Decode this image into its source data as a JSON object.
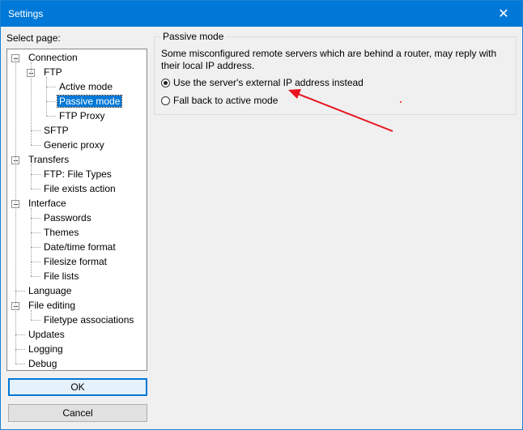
{
  "window": {
    "title": "Settings",
    "close_glyph": "✕"
  },
  "tree": {
    "label": "Select page:",
    "nodes": [
      {
        "label": "Connection",
        "level": 0,
        "expanded": true
      },
      {
        "label": "FTP",
        "level": 1,
        "expanded": true
      },
      {
        "label": "Active mode",
        "level": 2
      },
      {
        "label": "Passive mode",
        "level": 2,
        "selected": true
      },
      {
        "label": "FTP Proxy",
        "level": 2
      },
      {
        "label": "SFTP",
        "level": 1
      },
      {
        "label": "Generic proxy",
        "level": 1
      },
      {
        "label": "Transfers",
        "level": 0,
        "expanded": true
      },
      {
        "label": "FTP: File Types",
        "level": 1
      },
      {
        "label": "File exists action",
        "level": 1
      },
      {
        "label": "Interface",
        "level": 0,
        "expanded": true
      },
      {
        "label": "Passwords",
        "level": 1
      },
      {
        "label": "Themes",
        "level": 1
      },
      {
        "label": "Date/time format",
        "level": 1
      },
      {
        "label": "Filesize format",
        "level": 1
      },
      {
        "label": "File lists",
        "level": 1
      },
      {
        "label": "Language",
        "level": 0
      },
      {
        "label": "File editing",
        "level": 0,
        "expanded": true
      },
      {
        "label": "Filetype associations",
        "level": 1
      },
      {
        "label": "Updates",
        "level": 0
      },
      {
        "label": "Logging",
        "level": 0
      },
      {
        "label": "Debug",
        "level": 0
      }
    ]
  },
  "buttons": {
    "ok": "OK",
    "cancel": "Cancel"
  },
  "panel": {
    "group_title": "Passive mode",
    "description": "Some misconfigured remote servers which are behind a router, may reply with their local IP address.",
    "options": [
      {
        "label": "Use the server's external IP address instead",
        "checked": true
      },
      {
        "label": "Fall back to active mode",
        "checked": false
      }
    ]
  },
  "annotation_color": "#e8141e"
}
